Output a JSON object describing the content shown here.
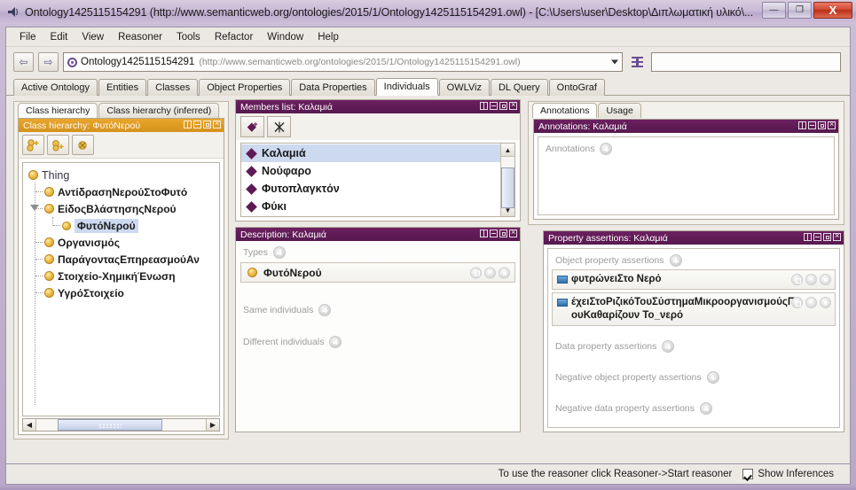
{
  "window": {
    "title": "Ontology1425115154291 (http://www.semanticweb.org/ontologies/2015/1/Ontology1425115154291.owl) - [C:\\Users\\user\\Desktop\\Διπλωματική υλικό\\...",
    "minimize_label": "—",
    "maximize_label": "❐",
    "close_label": "X"
  },
  "menubar": {
    "items": [
      {
        "label": "File"
      },
      {
        "label": "Edit"
      },
      {
        "label": "View"
      },
      {
        "label": "Reasoner"
      },
      {
        "label": "Tools"
      },
      {
        "label": "Refactor"
      },
      {
        "label": "Window"
      },
      {
        "label": "Help"
      }
    ]
  },
  "toolbar": {
    "back_label": "⇦",
    "forward_label": "⇨",
    "ontology_name": "Ontology1425115154291",
    "ontology_iri": "(http://www.semanticweb.org/ontologies/2015/1/Ontology1425115154291.owl)",
    "search_placeholder": ""
  },
  "tabs": [
    {
      "label": "Active Ontology",
      "active": false
    },
    {
      "label": "Entities",
      "active": false
    },
    {
      "label": "Classes",
      "active": false
    },
    {
      "label": "Object Properties",
      "active": false
    },
    {
      "label": "Data Properties",
      "active": false
    },
    {
      "label": "Individuals",
      "active": true
    },
    {
      "label": "OWLViz",
      "active": false
    },
    {
      "label": "DL Query",
      "active": false
    },
    {
      "label": "OntoGraf",
      "active": false
    }
  ],
  "class_hierarchy": {
    "tabs": [
      {
        "label": "Class hierarchy",
        "active": true
      },
      {
        "label": "Class hierarchy (inferred)",
        "active": false
      }
    ],
    "panel_title": "Class hierarchy:  ΦυτόΝερού",
    "tree": [
      {
        "label": "Thing",
        "level": 0,
        "selected": false,
        "expanded": false
      },
      {
        "label": "ΑντίδρασηΝερούΣτοΦυτό",
        "level": 1,
        "selected": false,
        "expanded": false
      },
      {
        "label": "ΕίδοςΒλάστησηςΝερού",
        "level": 1,
        "selected": false,
        "expanded": true
      },
      {
        "label": "ΦυτόΝερού",
        "level": 2,
        "selected": true,
        "expanded": false
      },
      {
        "label": "Οργανισμός",
        "level": 1,
        "selected": false,
        "expanded": false
      },
      {
        "label": "ΠαράγονταςΕπηρεασμούΑν",
        "level": 1,
        "selected": false,
        "expanded": false
      },
      {
        "label": "Στοιχείο-ΧημικήΈνωση",
        "level": 1,
        "selected": false,
        "expanded": false
      },
      {
        "label": "ΥγρόΣτοιχείο",
        "level": 1,
        "selected": false,
        "expanded": false
      }
    ]
  },
  "members_list": {
    "panel_title": "Members list: Καλαμιά",
    "items": [
      {
        "label": "Καλαμιά",
        "selected": true
      },
      {
        "label": "Νούφαρο",
        "selected": false
      },
      {
        "label": "Φυτοπλαγκτόν",
        "selected": false
      },
      {
        "label": "Φύκι",
        "selected": false
      }
    ]
  },
  "description": {
    "panel_title": "Description: Καλαμιά",
    "sections": [
      {
        "label": "Types"
      },
      {
        "label": "Same individuals"
      },
      {
        "label": "Different individuals"
      }
    ],
    "types_value": "ΦυτόΝερού"
  },
  "annotations": {
    "tabs": [
      {
        "label": "Annotations",
        "active": true
      },
      {
        "label": "Usage",
        "active": false
      }
    ],
    "panel_title": "Annotations: Καλαμιά",
    "section_label": "Annotations"
  },
  "property_assertions": {
    "panel_title": "Property assertions: Καλαμιά",
    "object_label": "Object property assertions",
    "assertions": [
      {
        "text": "φυτρώνειΣτο  Νερό"
      },
      {
        "text": "έχειΣτοΡιζικόΤουΣύστημαΜικροοργανισμούςΠουΚαθαρίζουν  Το_νερό"
      }
    ],
    "data_label": "Data property assertions",
    "negative_object_label": "Negative object property assertions",
    "negative_data_label": "Negative data property assertions"
  },
  "statusbar": {
    "reasoner_hint": "To use the reasoner click Reasoner->Start reasoner",
    "show_inferences_label": "Show Inferences"
  },
  "colors": {
    "panel_purple": "#5e1a54",
    "panel_gold": "#dd9a22",
    "selection_blue": "#cdd9ef",
    "node_gold": "#f0c04a",
    "window_chrome": "#c3b4d0"
  }
}
